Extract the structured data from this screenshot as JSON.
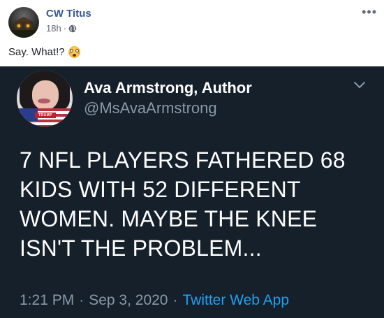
{
  "post": {
    "author": "CW Titus",
    "time": "18h",
    "separator": "·",
    "privacy_icon": "globe-icon",
    "more_icon": "more-options-icon",
    "more_label": "•••",
    "caption": "Say. What!?",
    "caption_emoji": "flushed-face-emoji"
  },
  "tweet": {
    "name": "Ava Armstrong, Author",
    "handle": "@MsAvaArmstrong",
    "avatar_banner_text": "TRUMP",
    "text": "7 NFL PLAYERS FATHERED 68\nKIDS WITH 52 DIFFERENT\nWOMEN. MAYBE THE KNEE\nISN'T THE PROBLEM...",
    "time": "1:21 PM",
    "sep1": "·",
    "date": "Sep 3, 2020",
    "sep2": "·",
    "app": "Twitter Web App",
    "colors": {
      "background": "#15202b",
      "link": "#1da1f2",
      "secondary": "#8899a6"
    }
  }
}
